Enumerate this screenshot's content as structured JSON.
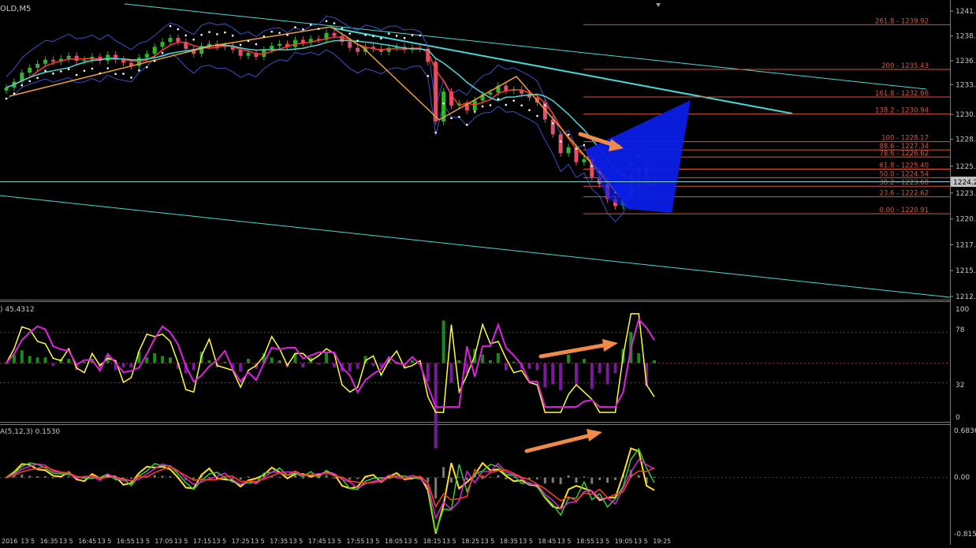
{
  "main_panel": {
    "symbol_label": "OLD,M5",
    "price_axis_labels": [
      "1241.3",
      "1238.8",
      "1236.3",
      "1233.9",
      "1230.9",
      "1228.4",
      "1225.7",
      "1223.0",
      "1220.4",
      "1217.8",
      "1215.2",
      "1212.6"
    ],
    "current_price": "1224.2",
    "fib_labels": [
      "261.8 - 1239.92",
      "200 - 1235.43",
      "161.8 - 1232.66",
      "138.2 - 1230.94",
      "100 - 1228.17",
      "88.6 - 1227.34",
      "78.6 - 1226.62",
      "61.8 - 1225.40",
      "50.0 - 1224.54",
      "38.2 - 1223.68",
      "23.6 - 1222.62",
      "0.00 - 1220.91"
    ]
  },
  "rsi_panel": {
    "label": ") 45.4312",
    "axis_labels": [
      "100",
      "78",
      "32",
      "0"
    ]
  },
  "macd_panel": {
    "label": "A(5,12,3) 0.1530",
    "axis_labels": [
      "0.6836",
      "0.00",
      "-0.8150"
    ]
  },
  "time_axis_labels": [
    "2016",
    "13 5",
    "16:35",
    "13 5",
    "16:45",
    "13 5",
    "16:55",
    "13 5",
    "17:05",
    "13 5",
    "17:15",
    "13 5",
    "17:25",
    "13 5",
    "17:35",
    "13 5",
    "17:45",
    "13 5",
    "17:55",
    "13 5",
    "18:05",
    "13 5",
    "18:15",
    "13 5",
    "18:25",
    "13 5",
    "18:35",
    "13 5",
    "18:45",
    "13 5",
    "18:55",
    "13 5",
    "19:05",
    "13 5",
    "19:25"
  ],
  "colors": {
    "bull": "#2fb52f",
    "bear": "#e0506a",
    "fib": "#d9543c",
    "cyan": "#48d8d8",
    "blue_band": "#3a4fc8",
    "pattern": "#0a1ee6",
    "arrow": "#f08a4b",
    "zigzag": "#f0a030",
    "rsi_line": "#ffff30",
    "rsi_ma": "#e020e0",
    "hist_up": "#1a8a1a",
    "hist_down": "#7a1a9a"
  },
  "chart_data": [
    {
      "type": "candlestick",
      "panel": "price",
      "title": "OLD,M5",
      "ylim": [
        1212.6,
        1241.3
      ],
      "close_series": [
        1233.6,
        1234.2,
        1235.1,
        1235.6,
        1236.0,
        1236.4,
        1236.2,
        1236.5,
        1236.8,
        1236.3,
        1236.4,
        1236.7,
        1236.3,
        1236.9,
        1236.4,
        1236.1,
        1235.8,
        1236.6,
        1237.0,
        1237.7,
        1238.2,
        1238.6,
        1238.2,
        1237.5,
        1237.0,
        1237.8,
        1238.0,
        1237.7,
        1237.8,
        1237.4,
        1236.8,
        1237.1,
        1236.7,
        1237.4,
        1237.8,
        1238.0,
        1237.7,
        1238.4,
        1238.1,
        1238.5,
        1238.4,
        1239.1,
        1238.8,
        1238.2,
        1237.6,
        1237.2,
        1237.7,
        1237.5,
        1237.2,
        1237.6,
        1237.7,
        1237.4,
        1237.6,
        1237.5,
        1236.2,
        1230.2,
        1233.2,
        1231.8,
        1232.0,
        1231.3,
        1232.3,
        1232.9,
        1233.1,
        1233.8,
        1233.3,
        1233.4,
        1233.0,
        1232.6,
        1232.1,
        1230.4,
        1228.9,
        1227.0,
        1227.6,
        1226.1,
        1226.4,
        1224.6,
        1223.9,
        1222.4,
        1221.7,
        1222.7,
        1224.9,
        1225.6,
        1224.0,
        1224.2
      ],
      "fib_levels": [
        {
          "ratio": "261.8",
          "price": 1239.92
        },
        {
          "ratio": "200",
          "price": 1235.43
        },
        {
          "ratio": "161.8",
          "price": 1232.66
        },
        {
          "ratio": "138.2",
          "price": 1230.94
        },
        {
          "ratio": "100",
          "price": 1228.17
        },
        {
          "ratio": "88.6",
          "price": 1227.34
        },
        {
          "ratio": "78.6",
          "price": 1226.62
        },
        {
          "ratio": "61.8",
          "price": 1225.4
        },
        {
          "ratio": "50.0",
          "price": 1224.54
        },
        {
          "ratio": "38.2",
          "price": 1223.68
        },
        {
          "ratio": "23.6",
          "price": 1222.62
        },
        {
          "ratio": "0.00",
          "price": 1220.91
        }
      ],
      "current_price": 1224.2,
      "grid": false
    },
    {
      "type": "line",
      "panel": "rsi",
      "title": ") 45.4312",
      "ylim": [
        0,
        100
      ],
      "levels": [
        78,
        32
      ]
    },
    {
      "type": "line",
      "panel": "macd",
      "title": "A(5,12,3) 0.1530",
      "ylim": [
        -0.815,
        0.6836
      ]
    }
  ]
}
